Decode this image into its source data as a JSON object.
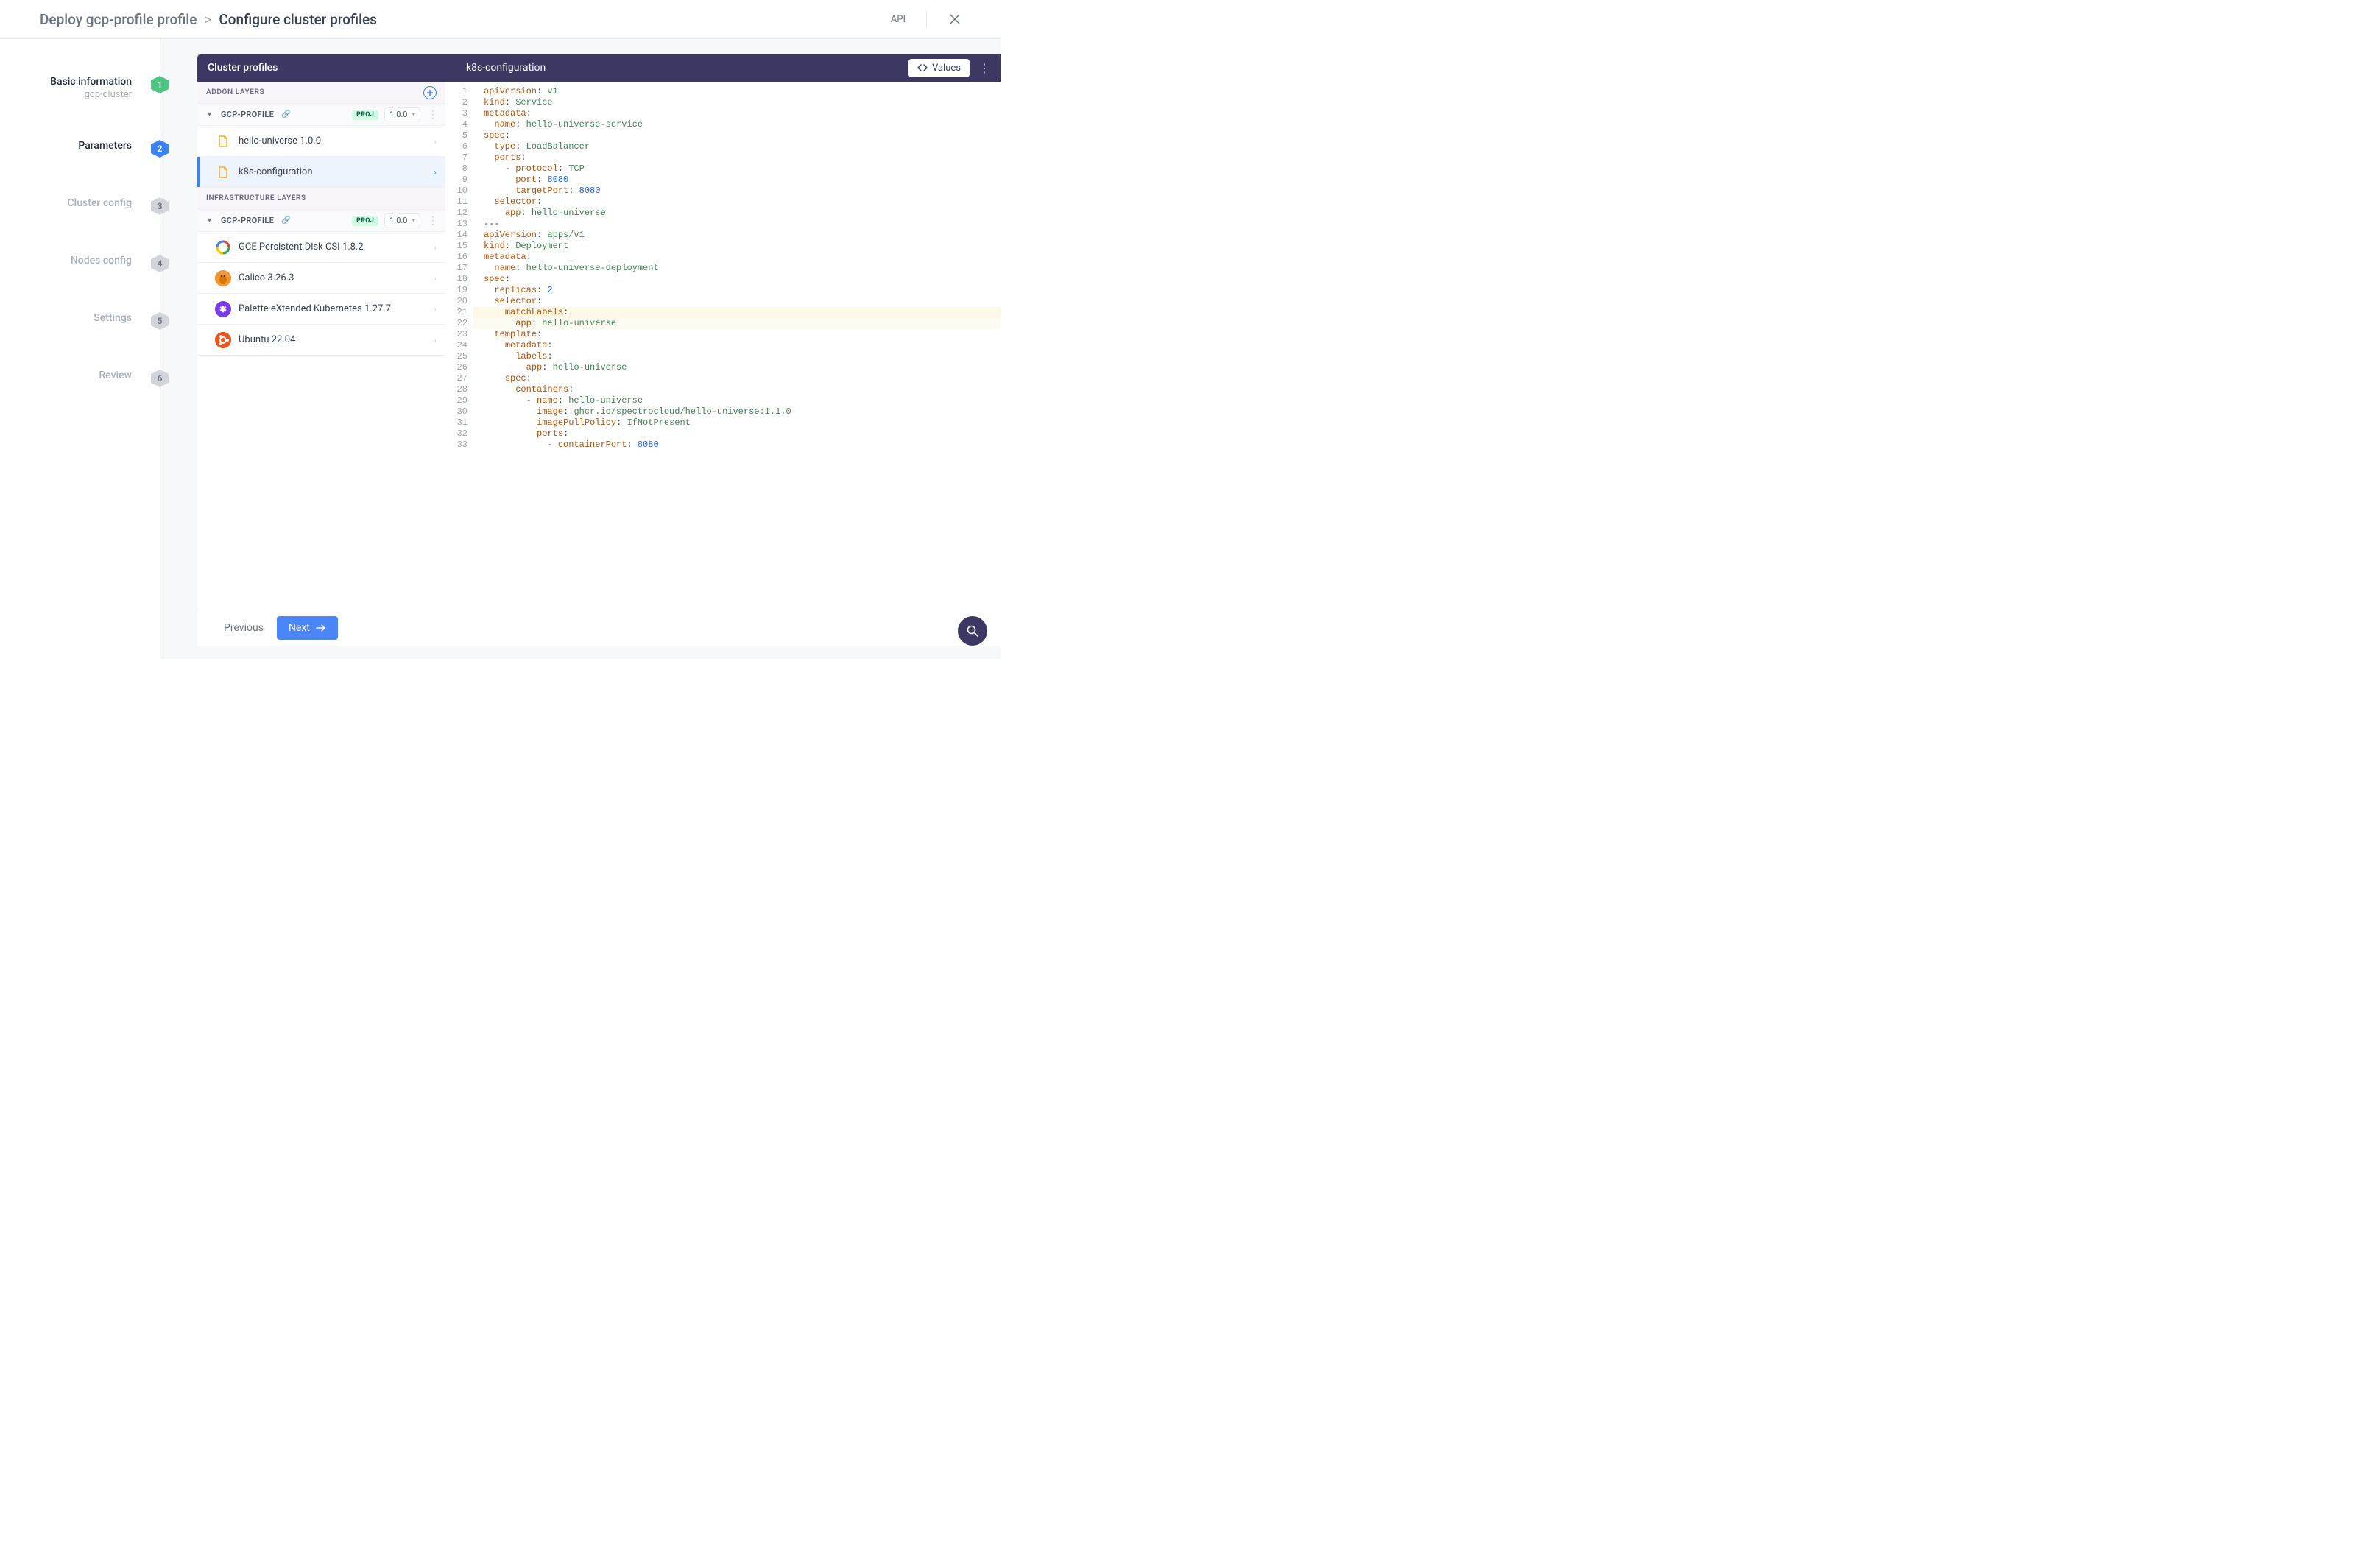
{
  "header": {
    "breadcrumb_root": "Deploy gcp-profile profile",
    "breadcrumb_sep": ">",
    "breadcrumb_current": "Configure cluster profiles",
    "api_label": "API"
  },
  "steps": [
    {
      "title": "Basic information",
      "sub": "gcp-cluster",
      "num": "1",
      "state": "done"
    },
    {
      "title": "Parameters",
      "sub": "",
      "num": "2",
      "state": "active"
    },
    {
      "title": "Cluster config",
      "sub": "",
      "num": "3",
      "state": "pending"
    },
    {
      "title": "Nodes config",
      "sub": "",
      "num": "4",
      "state": "pending"
    },
    {
      "title": "Settings",
      "sub": "",
      "num": "5",
      "state": "pending"
    },
    {
      "title": "Review",
      "sub": "",
      "num": "6",
      "state": "pending"
    }
  ],
  "profiles_panel": {
    "title": "Cluster profiles",
    "addon_label": "ADDON LAYERS",
    "infra_label": "INFRASTRUCTURE LAYERS",
    "profile_name": "GCP-PROFILE",
    "badge": "PROJ",
    "version": "1.0.0",
    "addon_layers": [
      {
        "label": "hello-universe 1.0.0",
        "icon": "doc",
        "selected": false
      },
      {
        "label": "k8s-configuration",
        "icon": "doc",
        "selected": true
      }
    ],
    "infra_layers": [
      {
        "label": "GCE Persistent Disk CSI 1.8.2",
        "icon": "disk"
      },
      {
        "label": "Calico 3.26.3",
        "icon": "calico"
      },
      {
        "label": "Palette eXtended Kubernetes 1.27.7",
        "icon": "pxk"
      },
      {
        "label": "Ubuntu 22.04",
        "icon": "ubuntu"
      }
    ]
  },
  "code_panel": {
    "title": "k8s-configuration",
    "values_label": "Values",
    "lines": [
      [
        {
          "t": "key",
          "v": "apiVersion"
        },
        {
          "t": "punc",
          "v": ": "
        },
        {
          "t": "str",
          "v": "v1"
        }
      ],
      [
        {
          "t": "key",
          "v": "kind"
        },
        {
          "t": "punc",
          "v": ": "
        },
        {
          "t": "str",
          "v": "Service"
        }
      ],
      [
        {
          "t": "key",
          "v": "metadata"
        },
        {
          "t": "punc",
          "v": ":"
        }
      ],
      [
        {
          "t": "ind",
          "v": 1
        },
        {
          "t": "key",
          "v": "name"
        },
        {
          "t": "punc",
          "v": ": "
        },
        {
          "t": "str",
          "v": "hello-universe-service"
        }
      ],
      [
        {
          "t": "key",
          "v": "spec"
        },
        {
          "t": "punc",
          "v": ":"
        }
      ],
      [
        {
          "t": "ind",
          "v": 1
        },
        {
          "t": "key",
          "v": "type"
        },
        {
          "t": "punc",
          "v": ": "
        },
        {
          "t": "str",
          "v": "LoadBalancer"
        }
      ],
      [
        {
          "t": "ind",
          "v": 1
        },
        {
          "t": "key",
          "v": "ports"
        },
        {
          "t": "punc",
          "v": ":"
        }
      ],
      [
        {
          "t": "ind",
          "v": 2
        },
        {
          "t": "dash",
          "v": "- "
        },
        {
          "t": "key",
          "v": "protocol"
        },
        {
          "t": "punc",
          "v": ": "
        },
        {
          "t": "str",
          "v": "TCP"
        }
      ],
      [
        {
          "t": "ind",
          "v": 3
        },
        {
          "t": "key",
          "v": "port"
        },
        {
          "t": "punc",
          "v": ": "
        },
        {
          "t": "num",
          "v": "8080"
        }
      ],
      [
        {
          "t": "ind",
          "v": 3
        },
        {
          "t": "key",
          "v": "targetPort"
        },
        {
          "t": "punc",
          "v": ": "
        },
        {
          "t": "num",
          "v": "8080"
        }
      ],
      [
        {
          "t": "ind",
          "v": 1
        },
        {
          "t": "key",
          "v": "selector"
        },
        {
          "t": "punc",
          "v": ":"
        }
      ],
      [
        {
          "t": "ind",
          "v": 2
        },
        {
          "t": "key",
          "v": "app"
        },
        {
          "t": "punc",
          "v": ": "
        },
        {
          "t": "str",
          "v": "hello-universe"
        }
      ],
      [
        {
          "t": "punc",
          "v": "---"
        }
      ],
      [
        {
          "t": "key",
          "v": "apiVersion"
        },
        {
          "t": "punc",
          "v": ": "
        },
        {
          "t": "str",
          "v": "apps/v1"
        }
      ],
      [
        {
          "t": "key",
          "v": "kind"
        },
        {
          "t": "punc",
          "v": ": "
        },
        {
          "t": "str",
          "v": "Deployment"
        }
      ],
      [
        {
          "t": "key",
          "v": "metadata"
        },
        {
          "t": "punc",
          "v": ":"
        }
      ],
      [
        {
          "t": "ind",
          "v": 1
        },
        {
          "t": "key",
          "v": "name"
        },
        {
          "t": "punc",
          "v": ": "
        },
        {
          "t": "str",
          "v": "hello-universe-deployment"
        }
      ],
      [
        {
          "t": "key",
          "v": "spec"
        },
        {
          "t": "punc",
          "v": ":"
        }
      ],
      [
        {
          "t": "ind",
          "v": 1
        },
        {
          "t": "key",
          "v": "replicas"
        },
        {
          "t": "punc",
          "v": ": "
        },
        {
          "t": "num",
          "v": "2"
        }
      ],
      [
        {
          "t": "ind",
          "v": 1
        },
        {
          "t": "key",
          "v": "selector"
        },
        {
          "t": "punc",
          "v": ":"
        }
      ],
      [
        {
          "t": "ind",
          "v": 2
        },
        {
          "t": "key",
          "v": "matchLabels"
        },
        {
          "t": "punc",
          "v": ":"
        }
      ],
      [
        {
          "t": "ind",
          "v": 3
        },
        {
          "t": "key",
          "v": "app"
        },
        {
          "t": "punc",
          "v": ": "
        },
        {
          "t": "str",
          "v": "hello-universe"
        }
      ],
      [
        {
          "t": "ind",
          "v": 1
        },
        {
          "t": "key",
          "v": "template"
        },
        {
          "t": "punc",
          "v": ":"
        }
      ],
      [
        {
          "t": "ind",
          "v": 2
        },
        {
          "t": "key",
          "v": "metadata"
        },
        {
          "t": "punc",
          "v": ":"
        }
      ],
      [
        {
          "t": "ind",
          "v": 3
        },
        {
          "t": "key",
          "v": "labels"
        },
        {
          "t": "punc",
          "v": ":"
        }
      ],
      [
        {
          "t": "ind",
          "v": 4
        },
        {
          "t": "key",
          "v": "app"
        },
        {
          "t": "punc",
          "v": ": "
        },
        {
          "t": "str",
          "v": "hello-universe"
        }
      ],
      [
        {
          "t": "ind",
          "v": 2
        },
        {
          "t": "key",
          "v": "spec"
        },
        {
          "t": "punc",
          "v": ":"
        }
      ],
      [
        {
          "t": "ind",
          "v": 3
        },
        {
          "t": "key",
          "v": "containers"
        },
        {
          "t": "punc",
          "v": ":"
        }
      ],
      [
        {
          "t": "ind",
          "v": 4
        },
        {
          "t": "dash",
          "v": "- "
        },
        {
          "t": "key",
          "v": "name"
        },
        {
          "t": "punc",
          "v": ": "
        },
        {
          "t": "str",
          "v": "hello-universe"
        }
      ],
      [
        {
          "t": "ind",
          "v": 5
        },
        {
          "t": "key",
          "v": "image"
        },
        {
          "t": "punc",
          "v": ": "
        },
        {
          "t": "str",
          "v": "ghcr.io/spectrocloud/hello-universe:1.1.0"
        }
      ],
      [
        {
          "t": "ind",
          "v": 5
        },
        {
          "t": "key",
          "v": "imagePullPolicy"
        },
        {
          "t": "punc",
          "v": ": "
        },
        {
          "t": "str",
          "v": "IfNotPresent"
        }
      ],
      [
        {
          "t": "ind",
          "v": 5
        },
        {
          "t": "key",
          "v": "ports"
        },
        {
          "t": "punc",
          "v": ":"
        }
      ],
      [
        {
          "t": "ind",
          "v": 6
        },
        {
          "t": "dash",
          "v": "- "
        },
        {
          "t": "key",
          "v": "containerPort"
        },
        {
          "t": "punc",
          "v": ": "
        },
        {
          "t": "num",
          "v": "8080"
        }
      ]
    ],
    "highlight_lines": [
      21
    ],
    "highlight_lines_soft": [
      22
    ]
  },
  "footer": {
    "prev": "Previous",
    "next": "Next"
  }
}
